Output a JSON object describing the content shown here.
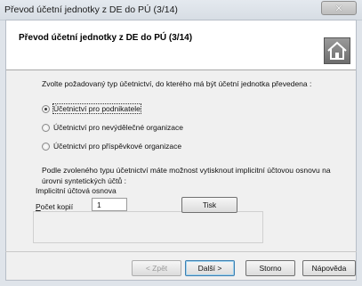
{
  "window": {
    "title": "Převod účetní jednotky z DE do PÚ (3/14)",
    "close_glyph": "✕"
  },
  "header": {
    "title": "Převod účetní jednotky z DE do PÚ (3/14)",
    "icon": "home-icon"
  },
  "body": {
    "instruction": "Zvolte požadovaný typ účetnictví, do kterého má být účetní jednotka převedena :",
    "options": [
      {
        "label": "Účetnictví pro podnikatele",
        "selected": true
      },
      {
        "label": "Účetnictví pro nevýdělečné organizace",
        "selected": false
      },
      {
        "label": "Účetnictví pro příspěvkové organizace",
        "selected": false
      }
    ],
    "note_line1": "Podle zvoleného typu účetnictví máte možnost vytisknout implicitní účtovou osnovu na",
    "note_line2": "úrovni syntetických účtů :"
  },
  "print_group": {
    "label": "Implicitní účtová osnova",
    "copies_label_accel": "P",
    "copies_label_rest": "očet kopií",
    "copies_value": "1",
    "print_button": "Tisk"
  },
  "footer": {
    "back": "< Zpět",
    "next": "Další >",
    "cancel": "Storno",
    "help": "Nápověda"
  }
}
